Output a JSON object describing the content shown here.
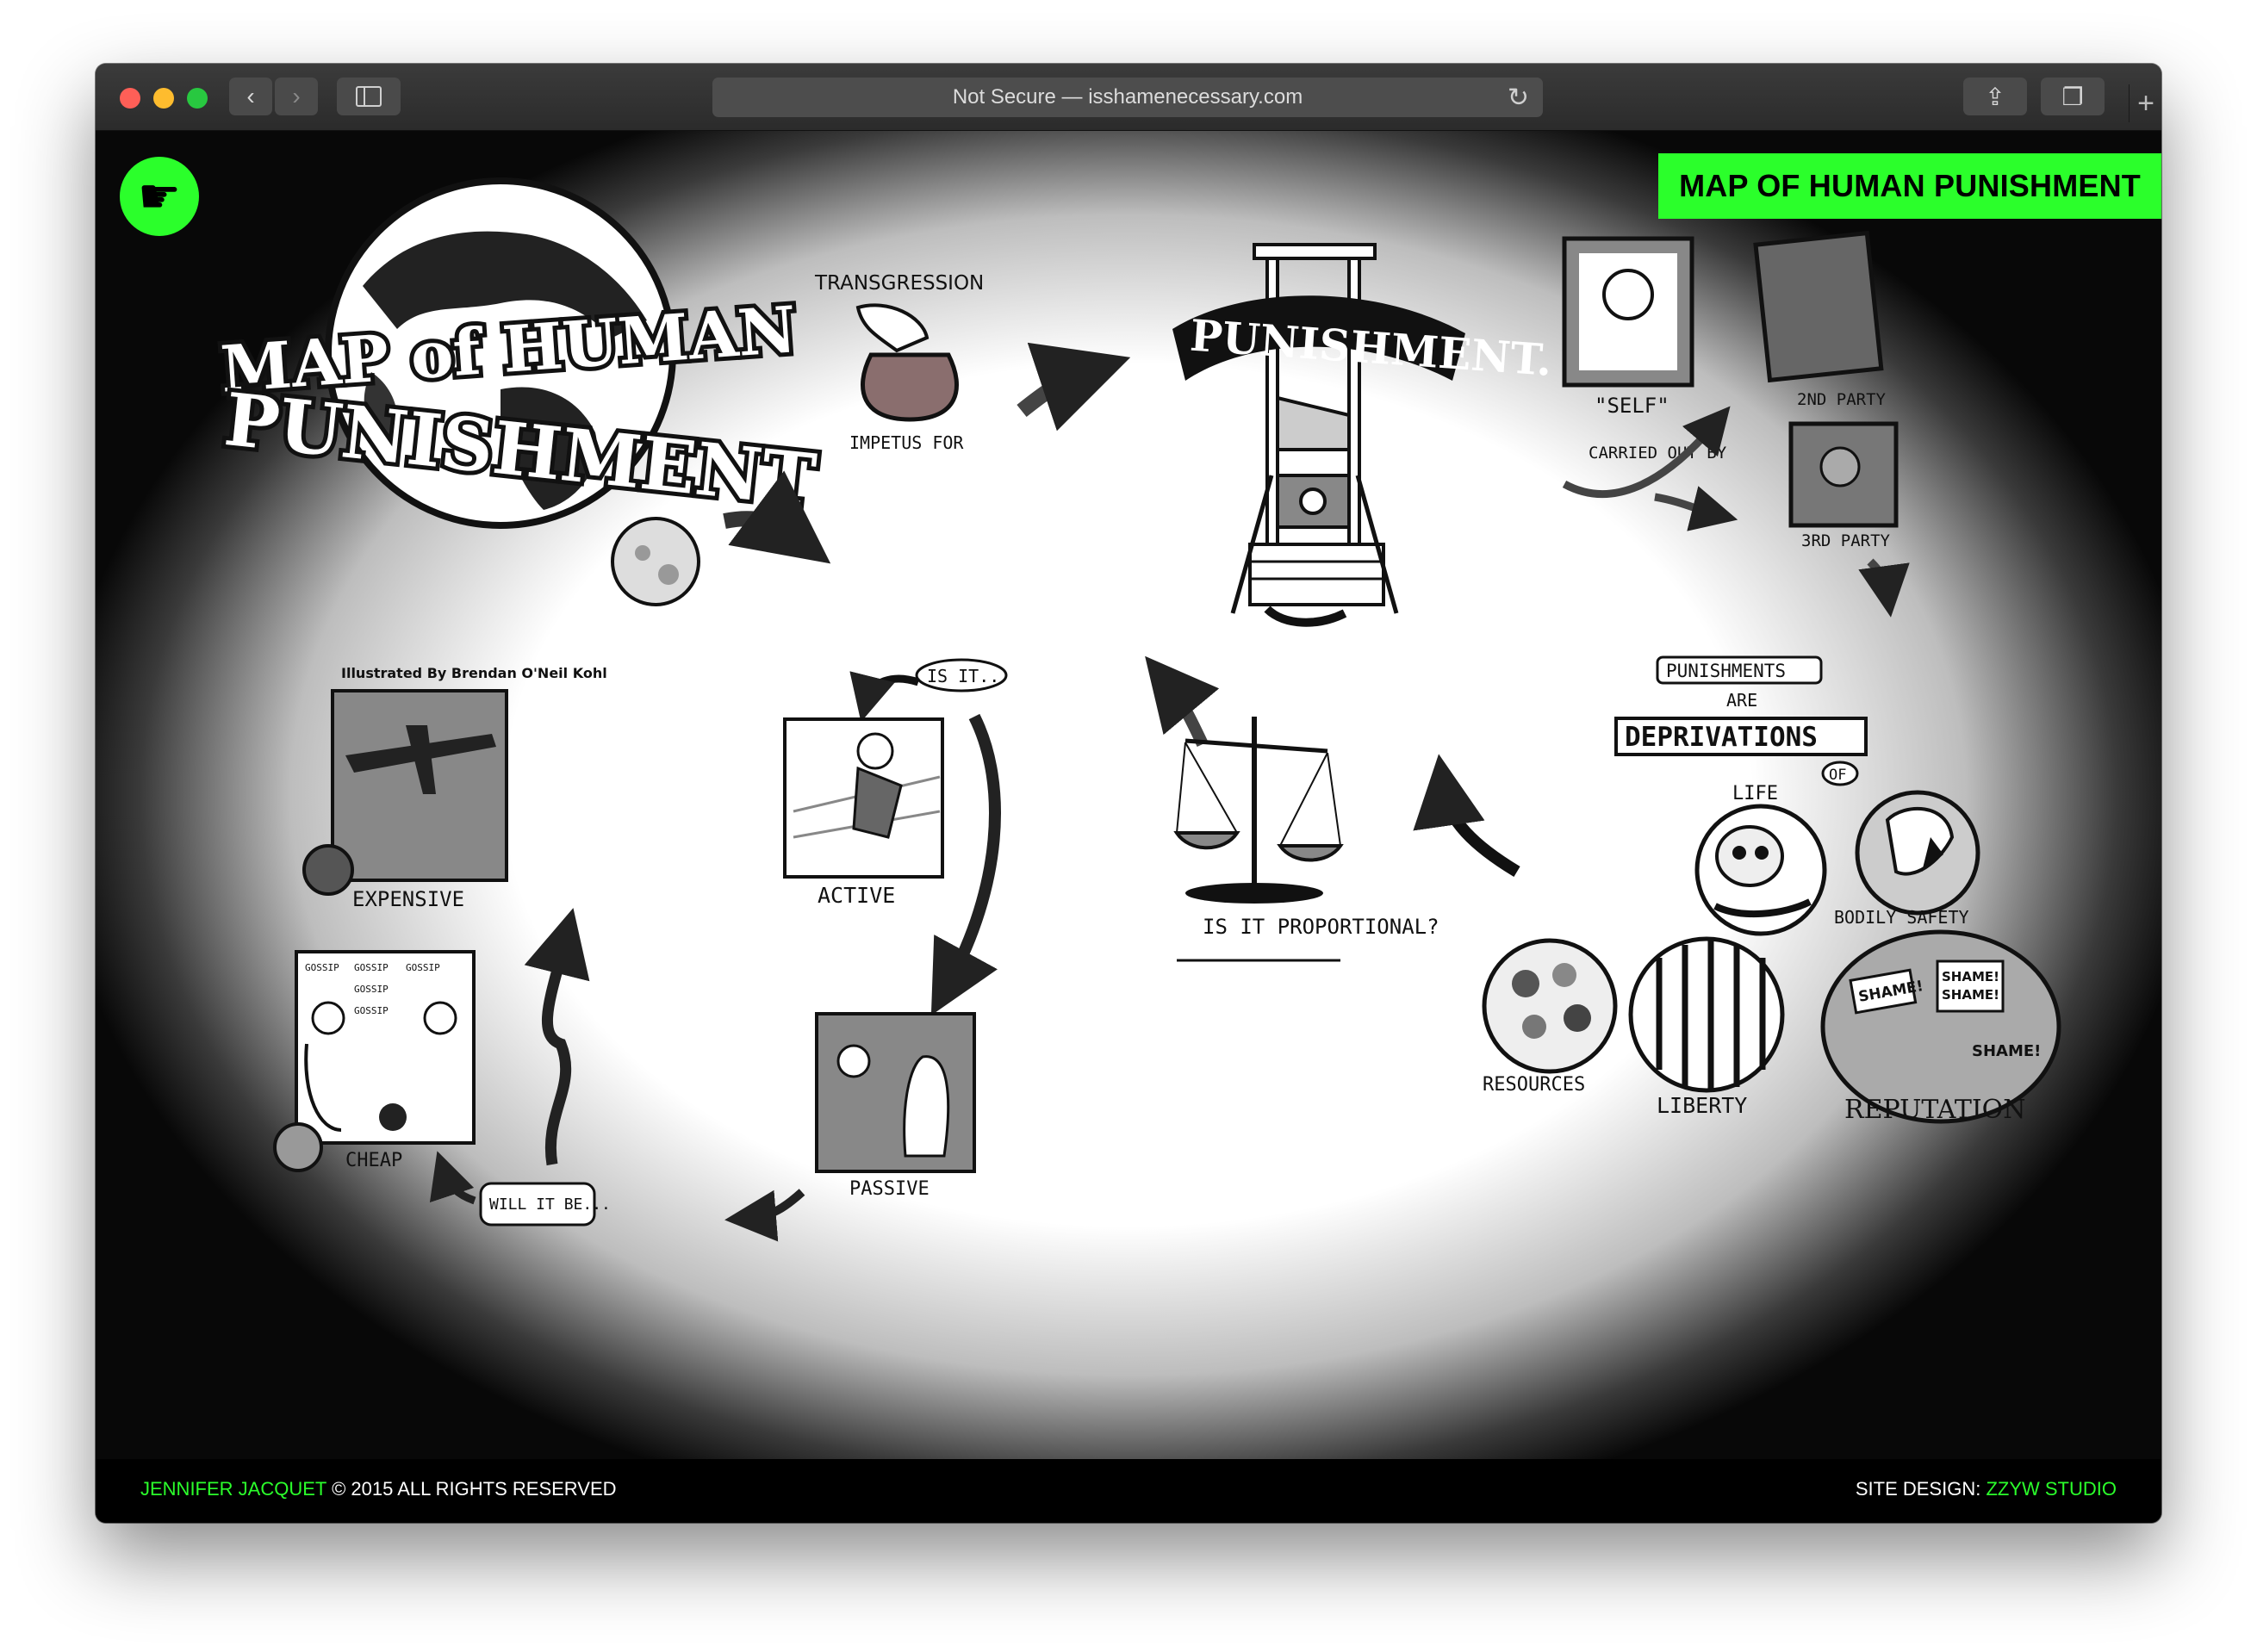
{
  "browser": {
    "address": "Not Secure — isshamenecessary.com",
    "back_icon": "chevron-left-icon",
    "forward_icon": "chevron-right-icon",
    "sidebar_icon": "sidebar-icon",
    "reload_icon": "reload-icon",
    "share_icon": "share-icon",
    "tabs_icon": "tabs-icon",
    "newtab_label": "+"
  },
  "page": {
    "badge": "MAP OF HUMAN PUNISHMENT",
    "accent": "#2bff2b",
    "logo_icon": "pointing-hand-icon",
    "map": {
      "title_top": "MAP of HUMAN",
      "title_bottom": "PUNISHMENT",
      "illustrator": "Illustrated By Brendan O'Neil Kohl",
      "transgression": "TRANSGRESSION",
      "impetus": "IMPETUS FOR",
      "punishment": "PUNISHMENT.",
      "self": "\"SELF\"",
      "second_party": "2ND PARTY",
      "third_party": "3RD PARTY",
      "carried_out_by": "CARRIED OUT BY",
      "punishments": "PUNISHMENTS",
      "are": "ARE",
      "deprivations": "DEPRIVATIONS",
      "of": "OF",
      "life": "LIFE",
      "bodily_safety": "BODILY SAFETY",
      "resources": "RESOURCES",
      "liberty": "LIBERTY",
      "reputation": "REPUTATION",
      "shame": "SHAME!",
      "is_it_proportional": "IS IT PROPORTIONAL?",
      "is_it": "IS IT..",
      "active": "ACTIVE",
      "passive": "PASSIVE",
      "will_it_be": "WILL IT BE...",
      "expensive": "EXPENSIVE",
      "cheap": "CHEAP",
      "gossip": "GOSSIP"
    }
  },
  "footer": {
    "author": "JENNIFER JACQUET",
    "copyright": " © 2015  ALL RIGHTS RESERVED",
    "design_label": "SITE DESIGN: ",
    "designer": "ZZYW STUDIO"
  }
}
